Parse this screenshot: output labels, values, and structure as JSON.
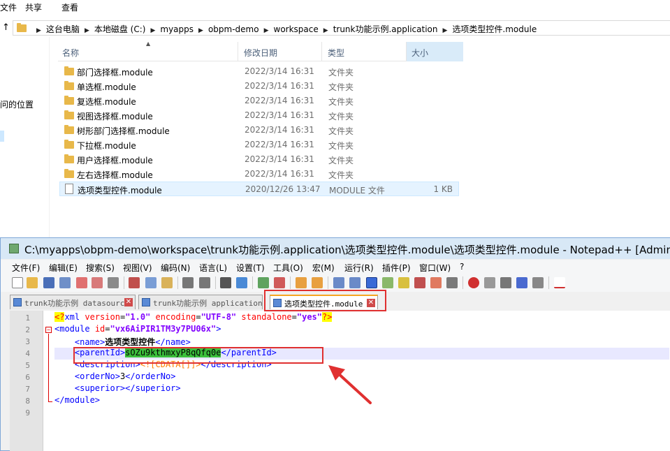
{
  "explorer": {
    "ribbon_tabs": [
      "文件",
      "共享",
      "查看"
    ],
    "address_crumbs": [
      "这台电脑",
      "本地磁盘 (C:)",
      "myapps",
      "obpm-demo",
      "workspace",
      "trunk功能示例.application",
      "选项类型控件.module"
    ],
    "nav_pane": {
      "item_partial": "问的位置"
    },
    "columns": {
      "name": "名称",
      "modified": "修改日期",
      "type": "类型",
      "size": "大小"
    },
    "files": [
      {
        "name": "部门选择框.module",
        "modified": "2022/3/14 16:31",
        "type": "文件夹",
        "size": "",
        "icon": "folder-icon"
      },
      {
        "name": "单选框.module",
        "modified": "2022/3/14 16:31",
        "type": "文件夹",
        "size": "",
        "icon": "folder-icon"
      },
      {
        "name": "复选框.module",
        "modified": "2022/3/14 16:31",
        "type": "文件夹",
        "size": "",
        "icon": "folder-icon"
      },
      {
        "name": "视图选择框.module",
        "modified": "2022/3/14 16:31",
        "type": "文件夹",
        "size": "",
        "icon": "folder-icon"
      },
      {
        "name": "树形部门选择框.module",
        "modified": "2022/3/14 16:31",
        "type": "文件夹",
        "size": "",
        "icon": "folder-icon"
      },
      {
        "name": "下拉框.module",
        "modified": "2022/3/14 16:31",
        "type": "文件夹",
        "size": "",
        "icon": "folder-icon"
      },
      {
        "name": "用户选择框.module",
        "modified": "2022/3/14 16:31",
        "type": "文件夹",
        "size": "",
        "icon": "folder-icon"
      },
      {
        "name": "左右选择框.module",
        "modified": "2022/3/14 16:31",
        "type": "文件夹",
        "size": "",
        "icon": "folder-icon"
      },
      {
        "name": "选项类型控件.module",
        "modified": "2020/12/26 13:47",
        "type": "MODULE 文件",
        "size": "1 KB",
        "icon": "file-icon"
      }
    ]
  },
  "notepad": {
    "title": "C:\\myapps\\obpm-demo\\workspace\\trunk功能示例.application\\选项类型控件.module\\选项类型控件.module - Notepad++ [Adminis",
    "menu": [
      "文件(F)",
      "编辑(E)",
      "搜索(S)",
      "视图(V)",
      "编码(N)",
      "语言(L)",
      "设置(T)",
      "工具(O)",
      "宏(M)",
      "运行(R)",
      "插件(P)",
      "窗口(W)",
      "?"
    ],
    "tabs": [
      {
        "label": "trunk功能示例 datasource"
      },
      {
        "label": "trunk功能示例 application"
      },
      {
        "label": "选项类型控件.module"
      }
    ],
    "line_numbers": [
      "1",
      "2",
      "3",
      "4",
      "5",
      "6",
      "7",
      "8",
      "9"
    ],
    "code": {
      "l1_open": "<?",
      "l1_tag": "xml",
      "l1_attr1": "version",
      "l1_val1": "\"1.0\"",
      "l1_attr2": "encoding",
      "l1_val2": "\"UTF-8\"",
      "l1_attr3": "standalone",
      "l1_val3": "\"yes\"",
      "l1_close": "?>",
      "l2_tag": "<module",
      "l2_attr": "id",
      "l2_val": "\"vx6AiPIR1TM3y7PU06x\"",
      "l2_close": ">",
      "l3_open": "<name>",
      "l3_text": "选项类型控件",
      "l3_close": "</name>",
      "l4_open": "<parentId>",
      "l4_text": "sOZu9kthmxyP8qQfq0e",
      "l4_close": "</parentId>",
      "l5_open": "<description>",
      "l5_cdata": "<![CDATA[]]>",
      "l5_close": "</description>",
      "l6_open": "<orderNo>",
      "l6_text": "3",
      "l6_close": "</orderNo>",
      "l7": "<superior></superior>",
      "l8": "</module>"
    }
  },
  "colors": {
    "annotation_red": "#e03030",
    "selection_green": "#3bbf3b",
    "active_tab_accent": "#f5a623"
  }
}
